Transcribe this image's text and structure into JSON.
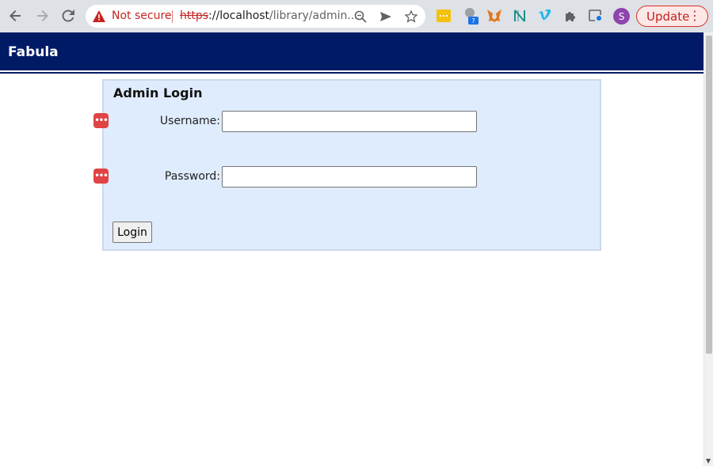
{
  "browser": {
    "security_label": "Not secure",
    "url_scheme": "https",
    "url_host": "://localhost",
    "url_path": "/library/admin...",
    "update_label": "Update",
    "avatar_letter": "S",
    "nav_icons": [
      "back-icon",
      "forward-icon",
      "reload-icon"
    ],
    "omnibox_icons": [
      "zoom-icon",
      "send-icon",
      "bookmark-star-icon"
    ],
    "extensions": [
      "extension-yellow-icon",
      "extension-badge-icon",
      "metamask-icon",
      "extension-n-icon",
      "vimeo-icon",
      "puzzle-icon",
      "media-icon"
    ]
  },
  "header": {
    "brand": "Fabula"
  },
  "login": {
    "title": "Admin Login",
    "username_label": "Username:",
    "username_value": "",
    "password_label": "Password:",
    "password_value": "",
    "submit_label": "Login"
  },
  "colors": {
    "header_bg": "#001a66",
    "panel_bg": "#dfecfd",
    "warning_red": "#c5221f"
  }
}
